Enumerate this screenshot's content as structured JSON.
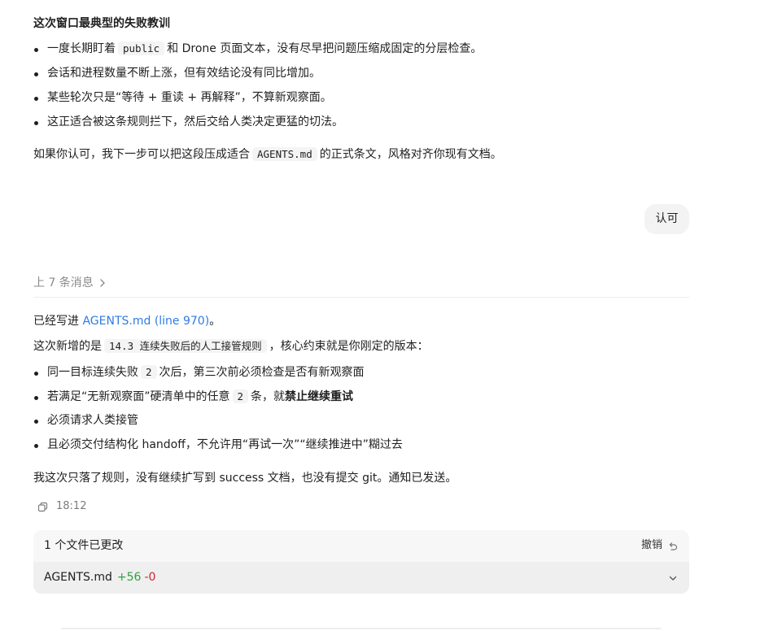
{
  "section1": {
    "heading": "这次窗口最典型的失败教训",
    "bullets": [
      {
        "pre": "一度长期盯着",
        "code": "public",
        "post": "和 Drone 页面文本，没有尽早把问题压缩成固定的分层检查。"
      },
      {
        "text": "会话和进程数量不断上涨，但有效结论没有同比增加。"
      },
      {
        "text": "某些轮次只是“等待 + 重读 + 再解释”，不算新观察面。"
      },
      {
        "text": "这正适合被这条规则拦下，然后交给人类决定更猛的切法。"
      }
    ],
    "closing": {
      "pre": "如果你认可，我下一步可以把这段压成适合",
      "code": "AGENTS.md",
      "post": "的正式条文，风格对齐你现有文档。"
    }
  },
  "user_message": "认可",
  "prev_messages": "上 7 条消息",
  "reply": {
    "line1_pre": "已经写进 ",
    "line1_link": "AGENTS.md (line 970)",
    "line1_post": "。",
    "line2_pre": "这次新增的是",
    "line2_code": "14.3 连续失败后的人工接管规则",
    "line2_post": "，核心约束就是你刚定的版本：",
    "b1_pre": "同一目标连续失败",
    "b1_code": "2",
    "b1_post": "次后，第三次前必须检查是否有新观察面",
    "b2_pre": "若满足“无新观察面”硬清单中的任意",
    "b2_code": "2",
    "b2_mid": "条，就",
    "b2_strong": "禁止继续重试",
    "b3": "必须请求人类接管",
    "b4": "且必须交付结构化 handoff，不允许用“再试一次”“继续推进中”糊过去",
    "closing": "我这次只落了规则，没有继续扩写到 success 文档，也没有提交 git。通知已发送。",
    "time": "18:12"
  },
  "files": {
    "header": "1 个文件已更改",
    "undo_label": "撤销",
    "file_name": "AGENTS.md",
    "additions": "+56",
    "deletions": "-0"
  }
}
